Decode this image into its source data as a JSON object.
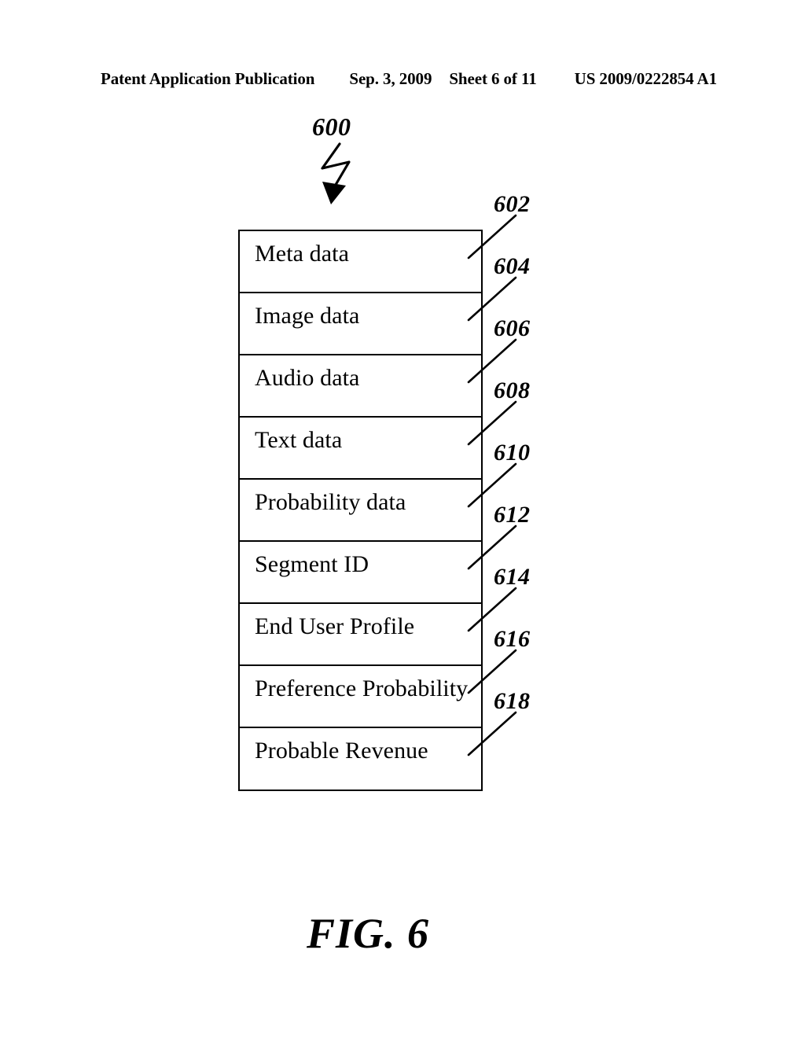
{
  "header": {
    "publication": "Patent Application Publication",
    "date": "Sep. 3, 2009",
    "sheet": "Sheet 6 of 11",
    "patent_number": "US 2009/0222854 A1"
  },
  "figure": {
    "caption": "FIG. 6",
    "diagram_ref": "600",
    "rows": [
      {
        "label": "Meta data",
        "ref": "602"
      },
      {
        "label": "Image data",
        "ref": "604"
      },
      {
        "label": "Audio data",
        "ref": "606"
      },
      {
        "label": "Text data",
        "ref": "608"
      },
      {
        "label": "Probability data",
        "ref": "610"
      },
      {
        "label": "Segment ID",
        "ref": "612"
      },
      {
        "label": "End User Profile",
        "ref": "614"
      },
      {
        "label": "Preference Probability",
        "ref": "616"
      },
      {
        "label": "Probable Revenue",
        "ref": "618"
      }
    ]
  },
  "colors": {
    "ink": "#000000",
    "paper": "#ffffff"
  }
}
